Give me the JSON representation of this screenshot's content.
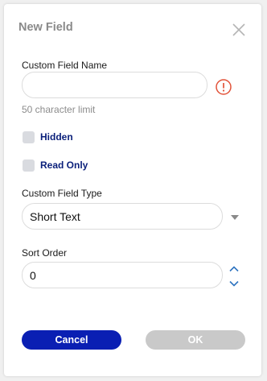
{
  "dialog": {
    "title": "New Field",
    "close_icon": "close-icon"
  },
  "name_field": {
    "label": "Custom Field Name",
    "value": "",
    "placeholder": "",
    "hint": "50 character limit",
    "warning_icon": "warning-icon",
    "warning_color": "#e2533a"
  },
  "checkboxes": {
    "hidden_label": "Hidden",
    "readonly_label": "Read Only"
  },
  "type_field": {
    "label": "Custom Field Type",
    "selected": "Short Text"
  },
  "sort_field": {
    "label": "Sort Order",
    "value": "0"
  },
  "buttons": {
    "cancel": "Cancel",
    "ok": "OK"
  },
  "colors": {
    "accent": "#0a1fb3",
    "disabled": "#c9c9c9",
    "spinner": "#2f74c0"
  }
}
